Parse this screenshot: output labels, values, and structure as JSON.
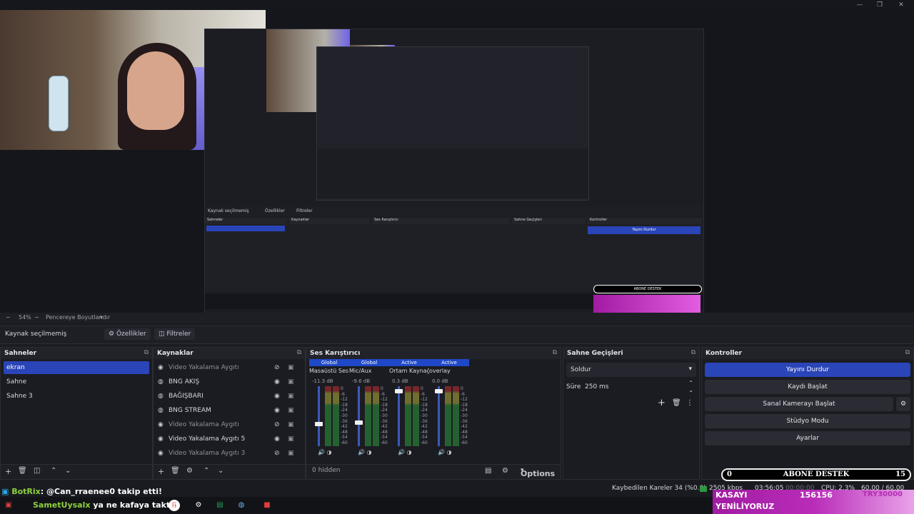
{
  "window": {
    "minimize": "—",
    "restore": "❐",
    "close": "✕"
  },
  "nested_preview": {
    "scene_label": "Kaynak seçilmemiş",
    "props": "Özellikler",
    "filters": "Filtreler",
    "scenes_title": "Sahneler",
    "sources_title": "Kaynaklar",
    "mixer_title": "Ses Karıştırıcı",
    "transitions_title": "Sahne Geçişleri",
    "controls_title": "Kontroller",
    "stop_stream": "Yayını Durdur",
    "abone": "ABONE DESTEK"
  },
  "preview_bar": {
    "zoom": "54%",
    "fit": "Pencereye Boyutlandır"
  },
  "source_bar": {
    "label": "Kaynak seçilmemiş",
    "properties": "Özellikler",
    "filters": "Filtreler"
  },
  "scenes": {
    "title": "Sahneler",
    "items": [
      {
        "label": "ekran",
        "selected": true
      },
      {
        "label": "Sahne"
      },
      {
        "label": "Sahne 3"
      }
    ]
  },
  "sources": {
    "title": "Kaynaklar",
    "items": [
      {
        "label": "Video Yakalama Aygıtı",
        "visible": false
      },
      {
        "label": "BNG AKIŞ",
        "visible": true
      },
      {
        "label": "BAĞIŞBARI",
        "visible": true
      },
      {
        "label": "BNG STREAM",
        "visible": true
      },
      {
        "label": "Video Yakalama Aygıtı",
        "visible": false
      },
      {
        "label": "Video Yakalama Aygıtı 5",
        "visible": true
      },
      {
        "label": "Video Yakalama Aygıtı 3",
        "visible": false
      }
    ]
  },
  "mixer": {
    "title": "Ses Karıştırıcı",
    "channels": [
      {
        "tag": "Global",
        "name": "Masaüstü Ses",
        "db": "-11.3 dB",
        "level": 0.36
      },
      {
        "tag": "Global",
        "name": "Mic/Aux",
        "db": "-9.6 dB",
        "level": 0.38
      },
      {
        "tag": "Active",
        "name": "Ortam Kaynağı",
        "db": "0.3 dB",
        "level": 0.95
      },
      {
        "tag": "Active",
        "name": "overlay",
        "db": "0.0 dB",
        "level": 0.95
      }
    ],
    "scale": [
      "0",
      "-6",
      "-12",
      "-18",
      "-24",
      "-30",
      "-36",
      "-42",
      "-48",
      "-54",
      "-60"
    ],
    "hidden": "0 hidden",
    "options": "Options"
  },
  "transitions": {
    "title": "Sahne Geçişleri",
    "type": "Soldur",
    "duration_label": "Süre",
    "duration": "250 ms"
  },
  "controls": {
    "title": "Kontroller",
    "stop_stream": "Yayını Durdur",
    "start_recording": "Kaydı Başlat",
    "virtual_cam": "Sanal Kamerayı Başlat",
    "studio_mode": "Stüdyo Modu",
    "settings": "Ayarlar"
  },
  "status": {
    "dropped": "Kaybedilen Kareler 34 (%0.0)",
    "bitrate": "2505 kbps",
    "stream_time": "03:56:05",
    "rec_time": "00:00:00",
    "cpu": "CPU: 2.3%",
    "fps": "60.00 / 60.00 FPS"
  },
  "overlay": {
    "abone_left": "0",
    "abone_title": "ABONE DESTEK",
    "abone_right": "15",
    "kasa_title": "KASAYI",
    "kasa_sub": "YENİLİYORUZ",
    "kasa_value": "156156",
    "kasa_target": "TRY30000"
  },
  "chat": {
    "line1_user": "BotRix",
    "line1_text": ": @Can_rraenee0 takip etti!",
    "line2_user": "SametUysalx",
    "line2_text": "ya ne kafaya taktın"
  },
  "colors": {
    "accent": "#2a45b8",
    "bg": "#1b1c22",
    "kasa": "#a01ca2"
  }
}
